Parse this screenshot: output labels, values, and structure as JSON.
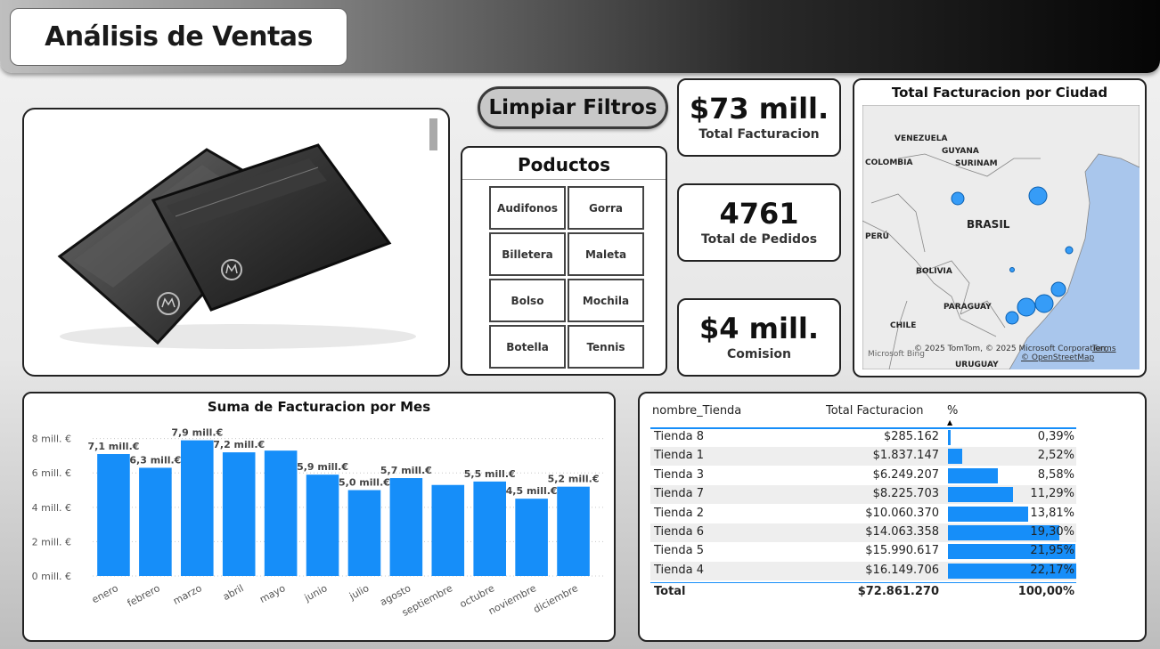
{
  "header": {
    "title": "Análisis de Ventas"
  },
  "clear_filters": {
    "label": "Limpiar Filtros"
  },
  "products": {
    "title": "Poductos",
    "items": [
      "Audifonos",
      "Gorra",
      "Billetera",
      "Maleta",
      "Bolso",
      "Mochila",
      "Botella",
      "Tennis"
    ]
  },
  "kpis": {
    "billing": {
      "value": "$73 mill.",
      "label": "Total Facturacion"
    },
    "orders": {
      "value": "4761",
      "label": "Total de Pedidos"
    },
    "commission": {
      "value": "$4 mill.",
      "label": "Comision"
    }
  },
  "map": {
    "title": "Total Facturacion por Ciudad",
    "labels": [
      "VENEZUELA",
      "GUYANA",
      "SURINAM",
      "COLOMBIA",
      "BRASIL",
      "PERÚ",
      "BOLIVIA",
      "PARAGUAY",
      "CHILE",
      "URUGUAY"
    ],
    "copyright": "© 2025 TomTom, © 2025 Microsoft Corporation,",
    "terms": "Terms",
    "osm": "© OpenStreetMap",
    "bing": "Microsoft Bing"
  },
  "colors": {
    "accent": "#168ef9",
    "border": "#222222"
  },
  "chart_data": {
    "type": "bar",
    "title": "Suma de Facturacion por Mes",
    "categories": [
      "enero",
      "febrero",
      "marzo",
      "abril",
      "mayo",
      "junio",
      "julio",
      "agosto",
      "septiembre",
      "octubre",
      "noviembre",
      "diciembre"
    ],
    "values": [
      7.1,
      6.3,
      7.9,
      7.2,
      7.3,
      5.9,
      5.0,
      5.7,
      5.3,
      5.5,
      4.5,
      5.2
    ],
    "data_labels": [
      "7,1 mill.€",
      "6,3 mill.€",
      "7,9 mill.€",
      "7,2 mill.€",
      "",
      "5,9 mill.€",
      "5,0 mill.€",
      "5,7 mill.€",
      "",
      "5,5 mill.€",
      "4,5 mill.€",
      "5,2 mill.€"
    ],
    "yticks": [
      0,
      2,
      4,
      6,
      8
    ],
    "ytick_labels": [
      "0 mill. €",
      "2 mill. €",
      "4 mill. €",
      "6 mill. €",
      "8 mill. €"
    ],
    "ylim": [
      0,
      8.5
    ],
    "grid": true,
    "color": "#168ef9"
  },
  "table": {
    "headers": {
      "store": "nombre_Tienda",
      "billing": "Total Facturacion",
      "pct": "%"
    },
    "rows": [
      {
        "store": "Tienda 8",
        "billing": "$285.162",
        "pct": "0,39%",
        "share": 0.39
      },
      {
        "store": "Tienda 1",
        "billing": "$1.837.147",
        "pct": "2,52%",
        "share": 2.52
      },
      {
        "store": "Tienda 3",
        "billing": "$6.249.207",
        "pct": "8,58%",
        "share": 8.58
      },
      {
        "store": "Tienda 7",
        "billing": "$8.225.703",
        "pct": "11,29%",
        "share": 11.29
      },
      {
        "store": "Tienda 2",
        "billing": "$10.060.370",
        "pct": "13,81%",
        "share": 13.81
      },
      {
        "store": "Tienda 6",
        "billing": "$14.063.358",
        "pct": "19,30%",
        "share": 19.3
      },
      {
        "store": "Tienda 5",
        "billing": "$15.990.617",
        "pct": "21,95%",
        "share": 21.95
      },
      {
        "store": "Tienda 4",
        "billing": "$16.149.706",
        "pct": "22,17%",
        "share": 22.17
      }
    ],
    "total": {
      "store": "Total",
      "billing": "$72.861.270",
      "pct": "100,00%"
    }
  }
}
